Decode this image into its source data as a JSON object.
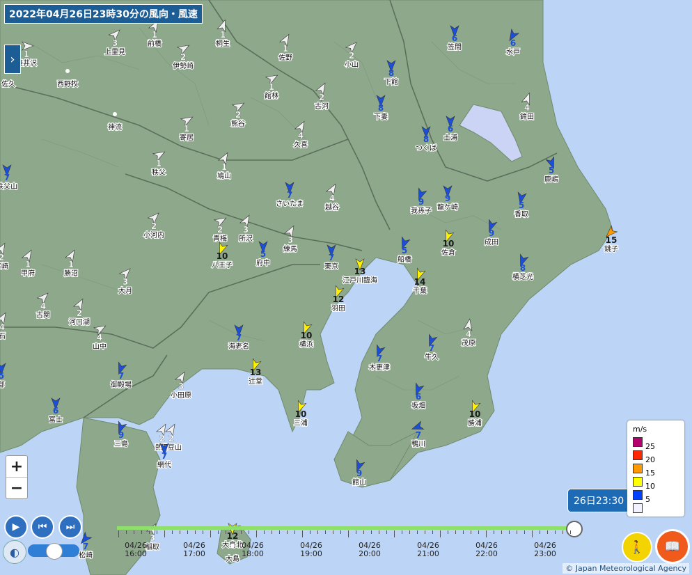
{
  "title": "2022年04月26日23時30分の風向・風速",
  "copyright": "© Japan Meteorological Agency",
  "timeline": {
    "current": "26日23:30",
    "labels": [
      {
        "date": "04/26",
        "time": "16:00"
      },
      {
        "date": "04/26",
        "time": "17:00"
      },
      {
        "date": "04/26",
        "time": "18:00"
      },
      {
        "date": "04/26",
        "time": "19:00"
      },
      {
        "date": "04/26",
        "time": "20:00"
      },
      {
        "date": "04/26",
        "time": "21:00"
      },
      {
        "date": "04/26",
        "time": "22:00"
      },
      {
        "date": "04/26",
        "time": "23:00"
      }
    ]
  },
  "legend": {
    "unit": "m/s",
    "items": [
      {
        "label": "25",
        "color": "#b4006e"
      },
      {
        "label": "20",
        "color": "#ff2800"
      },
      {
        "label": "15",
        "color": "#ff9900"
      },
      {
        "label": "10",
        "color": "#ffff00"
      },
      {
        "label": "5",
        "color": "#0041ff"
      },
      {
        "label": "",
        "color": "#f2f2ff"
      }
    ]
  },
  "colors": {
    "calm": "#f0f0f0",
    "low": "#1b4fd8",
    "mid": "#fff200",
    "high": "#ff9a00",
    "land": "#8ea88c",
    "sea": "#bcd4f5"
  },
  "stations": [
    {
      "name": "軽井沢",
      "speed": "1",
      "dir": 90
    },
    {
      "name": "佐久",
      "speed": "",
      "dir": 0
    },
    {
      "name": "上里見",
      "speed": "3",
      "dir": 45
    },
    {
      "name": "前橋",
      "speed": "1",
      "dir": 30
    },
    {
      "name": "桐生",
      "speed": "1",
      "dir": 20
    },
    {
      "name": "伊勢崎",
      "speed": "2",
      "dir": 60
    },
    {
      "name": "西野牧",
      "speed": "",
      "dir": 0
    },
    {
      "name": "佐野",
      "speed": "1",
      "dir": 30
    },
    {
      "name": "小山",
      "speed": "2",
      "dir": 45
    },
    {
      "name": "館林",
      "speed": "1",
      "dir": 60
    },
    {
      "name": "古河",
      "speed": "2",
      "dir": 30
    },
    {
      "name": "下館",
      "speed": "8",
      "dir": 180
    },
    {
      "name": "下妻",
      "speed": "8",
      "dir": 180
    },
    {
      "name": "笠間",
      "speed": "6",
      "dir": 180
    },
    {
      "name": "水戸",
      "speed": "6",
      "dir": 210
    },
    {
      "name": "熊谷",
      "speed": "2",
      "dir": 60
    },
    {
      "name": "寄居",
      "speed": "1",
      "dir": 60
    },
    {
      "name": "神流",
      "speed": "",
      "dir": 0
    },
    {
      "name": "久喜",
      "speed": "4",
      "dir": 30
    },
    {
      "name": "つくば",
      "speed": "8",
      "dir": 180
    },
    {
      "name": "土浦",
      "speed": "6",
      "dir": 180
    },
    {
      "name": "鉾田",
      "speed": "4",
      "dir": 20
    },
    {
      "name": "秩父",
      "speed": "1",
      "dir": 60
    },
    {
      "name": "鳩山",
      "speed": "1",
      "dir": 30
    },
    {
      "name": "鹿嶋",
      "speed": "5",
      "dir": 160
    },
    {
      "name": "さいたま",
      "speed": "7",
      "dir": 180
    },
    {
      "name": "越谷",
      "speed": "4",
      "dir": 30
    },
    {
      "name": "我孫子",
      "speed": "9",
      "dir": 200
    },
    {
      "name": "龍ケ崎",
      "speed": "9",
      "dir": 180
    },
    {
      "name": "香取",
      "speed": "5",
      "dir": 190
    },
    {
      "name": "小河内",
      "speed": "2",
      "dir": 45
    },
    {
      "name": "青梅",
      "speed": "2",
      "dir": 60
    },
    {
      "name": "所沢",
      "speed": "3",
      "dir": 30
    },
    {
      "name": "練馬",
      "speed": "3",
      "dir": 30
    },
    {
      "name": "成田",
      "speed": "9",
      "dir": 200
    },
    {
      "name": "銚子",
      "speed": "15",
      "dir": 225
    },
    {
      "name": "八王子",
      "speed": "10",
      "dir": 200
    },
    {
      "name": "府中",
      "speed": "5",
      "dir": 180
    },
    {
      "name": "東京",
      "speed": "7",
      "dir": 180
    },
    {
      "name": "船橋",
      "speed": "5",
      "dir": 200
    },
    {
      "name": "佐倉",
      "speed": "10",
      "dir": 200
    },
    {
      "name": "甲府",
      "speed": "1",
      "dir": 30
    },
    {
      "name": "勝沼",
      "speed": "1",
      "dir": 30
    },
    {
      "name": "大月",
      "speed": "3",
      "dir": 45
    },
    {
      "name": "江戸川臨海",
      "speed": "13",
      "dir": 180
    },
    {
      "name": "横芝光",
      "speed": "8",
      "dir": 200
    },
    {
      "name": "千葉",
      "speed": "14",
      "dir": 200
    },
    {
      "name": "羽田",
      "speed": "12",
      "dir": 200
    },
    {
      "name": "古関",
      "speed": "4",
      "dir": 45
    },
    {
      "name": "河口湖",
      "speed": "2",
      "dir": 30
    },
    {
      "name": "山中",
      "speed": "4",
      "dir": 60
    },
    {
      "name": "海老名",
      "speed": "7",
      "dir": 180
    },
    {
      "name": "横浜",
      "speed": "10",
      "dir": 200
    },
    {
      "name": "茂原",
      "speed": "4",
      "dir": 10
    },
    {
      "name": "木更津",
      "speed": "7",
      "dir": 200
    },
    {
      "name": "牛久",
      "speed": "7",
      "dir": 200
    },
    {
      "name": "御殿場",
      "speed": "7",
      "dir": 200
    },
    {
      "name": "辻堂",
      "speed": "13",
      "dir": 200
    },
    {
      "name": "小田原",
      "speed": "3",
      "dir": 30
    },
    {
      "name": "坂畑",
      "speed": "6",
      "dir": 200
    },
    {
      "name": "富士",
      "speed": "6",
      "dir": 180
    },
    {
      "name": "三浦",
      "speed": "10",
      "dir": 200
    },
    {
      "name": "勝浦",
      "speed": "10",
      "dir": 200
    },
    {
      "name": "鴨川",
      "speed": "7",
      "dir": 250
    },
    {
      "name": "三島",
      "speed": "9",
      "dir": 200
    },
    {
      "name": "熱海",
      "speed": "2",
      "dir": 30
    },
    {
      "name": "伊豆山",
      "speed": "2",
      "dir": 30
    },
    {
      "name": "網代",
      "speed": "7",
      "dir": 180
    },
    {
      "name": "館山",
      "speed": "9",
      "dir": 200
    },
    {
      "name": "稲取",
      "speed": "3",
      "dir": 30
    },
    {
      "name": "大島北",
      "speed": "12",
      "dir": 180
    },
    {
      "name": "大島",
      "speed": "",
      "dir": 0
    },
    {
      "name": "松崎",
      "speed": "7",
      "dir": 220
    },
    {
      "name": "秩父山",
      "speed": "7",
      "dir": 180
    },
    {
      "name": "韮崎",
      "speed": "2",
      "dir": 30
    },
    {
      "name": "石",
      "speed": "4",
      "dir": 30
    },
    {
      "name": "部",
      "speed": "5",
      "dir": 180
    }
  ]
}
